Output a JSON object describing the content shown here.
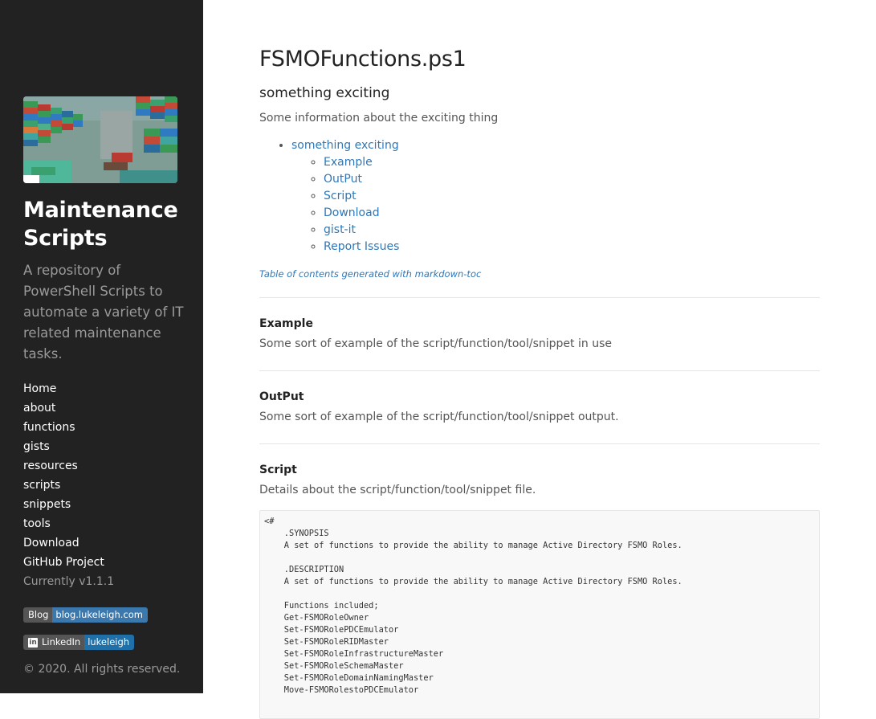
{
  "sidebar": {
    "title": "Maintenance Scripts",
    "tagline": "A repository of PowerShell Scripts to automate a variety of IT related maintenance tasks.",
    "nav": [
      "Home",
      "about",
      "functions",
      "gists",
      "resources",
      "scripts",
      "snippets",
      "tools",
      "Download",
      "GitHub Project"
    ],
    "version": "Currently v1.1.1",
    "badge_blog": {
      "left": "Blog",
      "right": "blog.lukeleigh.com"
    },
    "badge_linkedin": {
      "left": "LinkedIn",
      "right": "lukeleigh"
    },
    "copyright": "© 2020. All rights reserved."
  },
  "main": {
    "title": "FSMOFunctions.ps1",
    "subtitle": "something exciting",
    "intro": "Some information about the exciting thing",
    "toc_top": "something exciting",
    "toc": [
      "Example",
      "OutPut",
      "Script",
      "Download",
      "gist-it",
      "Report Issues"
    ],
    "toc_note": "Table of contents generated with markdown-toc",
    "sections": [
      {
        "heading": "Example",
        "text": "Some sort of example of the script/function/tool/snippet in use"
      },
      {
        "heading": "OutPut",
        "text": "Some sort of example of the script/function/tool/snippet output."
      },
      {
        "heading": "Script",
        "text": "Details about the script/function/tool/snippet file."
      }
    ],
    "code": "<#\n    .SYNOPSIS\n    A set of functions to provide the ability to manage Active Directory FSMO Roles.\n\n    .DESCRIPTION\n    A set of functions to provide the ability to manage Active Directory FSMO Roles.\n\n    Functions included;\n    Get-FSMORoleOwner\n    Set-FSMORolePDCEmulator\n    Set-FSMORoleRIDMaster\n    Set-FSMORoleInfrastructureMaster\n    Set-FSMORoleSchemaMaster\n    Set-FSMORoleDomainNamingMaster\n    Move-FSMORolestoPDCEmulator"
  },
  "colors": {
    "sidebar_bg": "#222222",
    "link": "#2f77b7",
    "badge_blog_right": "#3a78ad",
    "badge_linkedin_right": "#1f6fa8"
  }
}
